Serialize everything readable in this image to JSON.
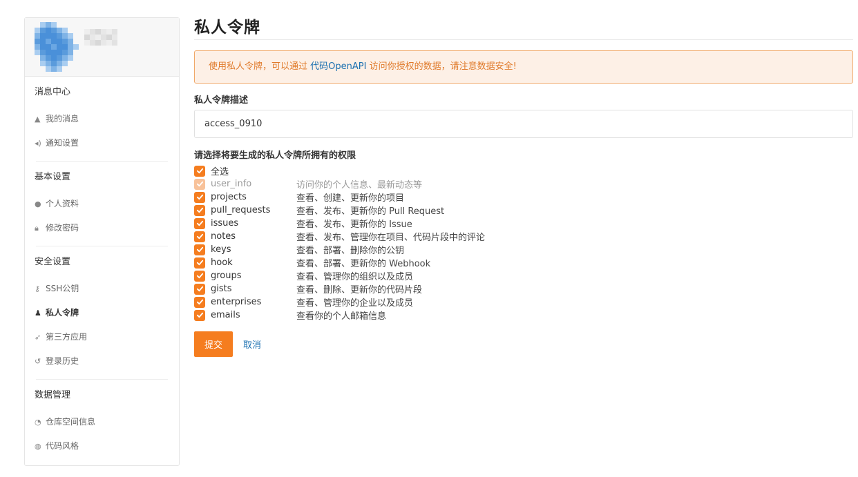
{
  "sidebar": {
    "sections": [
      {
        "title": "消息中心",
        "items": [
          {
            "label": "我的消息",
            "icon": "bell-icon",
            "glyph": "▲",
            "active": false
          },
          {
            "label": "通知设置",
            "icon": "speaker-icon",
            "glyph": "◂)",
            "active": false
          }
        ]
      },
      {
        "title": "基本设置",
        "items": [
          {
            "label": "个人资料",
            "icon": "user-icon",
            "glyph": "●",
            "active": false
          },
          {
            "label": "修改密码",
            "icon": "lock-icon",
            "glyph": "🔒︎",
            "active": false
          }
        ]
      },
      {
        "title": "安全设置",
        "items": [
          {
            "label": "SSH公钥",
            "icon": "key-icon",
            "glyph": "⚷",
            "active": false
          },
          {
            "label": "私人令牌",
            "icon": "user-secret-icon",
            "glyph": "♟",
            "active": true
          },
          {
            "label": "第三方应用",
            "icon": "rocket-icon",
            "glyph": "➶",
            "active": false
          },
          {
            "label": "登录历史",
            "icon": "history-icon",
            "glyph": "↺",
            "active": false
          }
        ]
      },
      {
        "title": "数据管理",
        "items": [
          {
            "label": "仓库空间信息",
            "icon": "pie-chart-icon",
            "glyph": "◔",
            "active": false
          },
          {
            "label": "代码风格",
            "icon": "gamepad-icon",
            "glyph": "◍",
            "active": false
          }
        ]
      }
    ]
  },
  "main": {
    "title": "私人令牌",
    "notice": {
      "prefix": "使用私人令牌，可以通过 ",
      "link": "代码OpenAPI",
      "suffix": " 访问你授权的数据，请注意数据安全!"
    },
    "description_label": "私人令牌描述",
    "description_value": "access_0910",
    "permissions_label": "请选择将要生成的私人令牌所拥有的权限",
    "select_all": "全选",
    "permissions": [
      {
        "name": "user_info",
        "desc": "访问你的个人信息、最新动态等",
        "checked": true,
        "disabled": true
      },
      {
        "name": "projects",
        "desc": "查看、创建、更新你的项目",
        "checked": true,
        "disabled": false
      },
      {
        "name": "pull_requests",
        "desc": "查看、发布、更新你的 Pull Request",
        "checked": true,
        "disabled": false
      },
      {
        "name": "issues",
        "desc": "查看、发布、更新你的 Issue",
        "checked": true,
        "disabled": false
      },
      {
        "name": "notes",
        "desc": "查看、发布、管理你在项目、代码片段中的评论",
        "checked": true,
        "disabled": false
      },
      {
        "name": "keys",
        "desc": "查看、部署、删除你的公钥",
        "checked": true,
        "disabled": false
      },
      {
        "name": "hook",
        "desc": "查看、部署、更新你的 Webhook",
        "checked": true,
        "disabled": false
      },
      {
        "name": "groups",
        "desc": "查看、管理你的组织以及成员",
        "checked": true,
        "disabled": false
      },
      {
        "name": "gists",
        "desc": "查看、删除、更新你的代码片段",
        "checked": true,
        "disabled": false
      },
      {
        "name": "enterprises",
        "desc": "查看、管理你的企业以及成员",
        "checked": true,
        "disabled": false
      },
      {
        "name": "emails",
        "desc": "查看你的个人邮箱信息",
        "checked": true,
        "disabled": false
      }
    ],
    "submit_label": "提交",
    "cancel_label": "取消"
  },
  "colors": {
    "accent": "#f57d1f",
    "accent_disabled": "#f8c29a",
    "notice_bg": "#fdf0e6",
    "notice_border": "#f0a868",
    "notice_text": "#e07a2a",
    "link": "#1a6fb0"
  }
}
